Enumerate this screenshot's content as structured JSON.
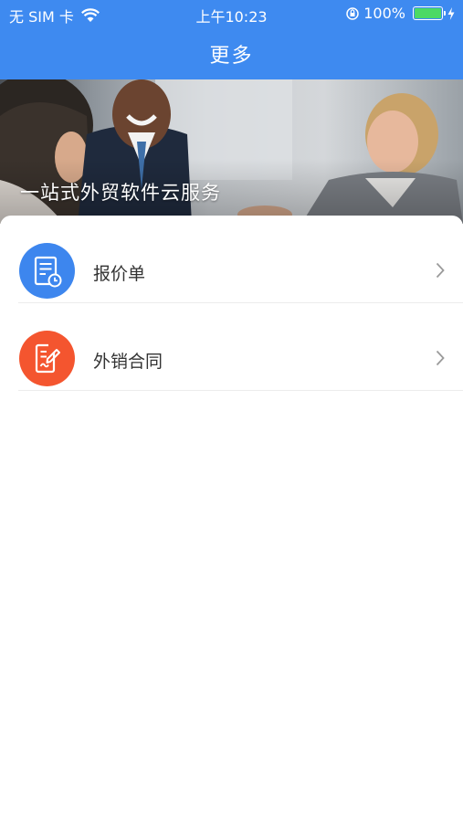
{
  "status_bar": {
    "carrier": "无 SIM 卡",
    "time": "上午10:23",
    "battery_percent": "100%",
    "battery_level": 1.0,
    "icons": [
      "wifi-icon",
      "orientation-lock-icon",
      "battery-icon",
      "charging-icon"
    ]
  },
  "nav": {
    "title": "更多"
  },
  "banner": {
    "caption": "一站式外贸软件云服务"
  },
  "menu": {
    "items": [
      {
        "label": "报价单",
        "icon": "quotation-icon",
        "icon_color": "#3d86ee"
      },
      {
        "label": "外销合同",
        "icon": "contract-icon",
        "icon_color": "#f4552f"
      }
    ]
  },
  "colors": {
    "primary": "#3e8af0",
    "quotation_icon_bg": "#3d86ee",
    "contract_icon_bg": "#f4552f",
    "battery_fill": "#4cd964",
    "divider": "#ececec"
  }
}
